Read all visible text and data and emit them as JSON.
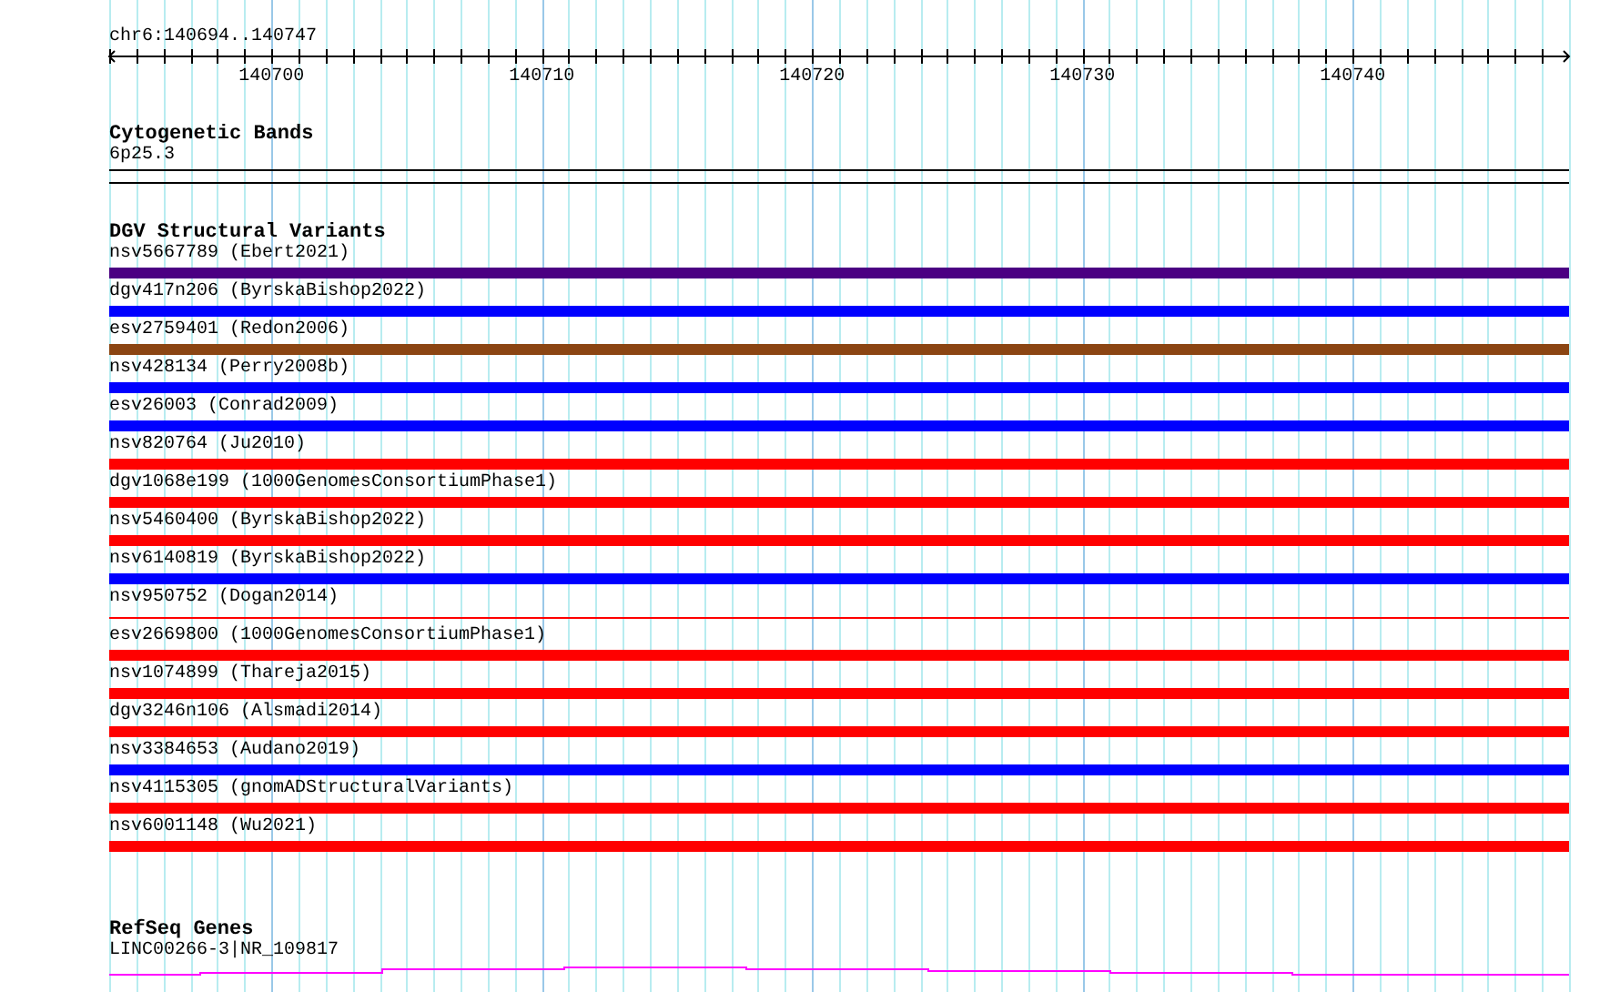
{
  "ruler": {
    "location": "chr6:140694..140747",
    "labels": [
      "140700",
      "140710",
      "140720",
      "140730",
      "140740"
    ]
  },
  "tracks": [
    {
      "kind": "bands",
      "title": "Cytogenetic Bands",
      "features": [
        {
          "label": "6p25.3"
        }
      ]
    },
    {
      "kind": "variants",
      "title": "DGV Structural Variants",
      "features": [
        {
          "label": "nsv5667789 (Ebert2021)",
          "kind": "bar",
          "color": "#4b0082"
        },
        {
          "label": "dgv417n206 (ByrskaBishop2022)",
          "kind": "bar",
          "color": "#0000ff"
        },
        {
          "label": "esv2759401 (Redon2006)",
          "kind": "bar",
          "color": "#8b4513"
        },
        {
          "label": "nsv428134 (Perry2008b)",
          "kind": "bar",
          "color": "#0000ff"
        },
        {
          "label": "esv26003 (Conrad2009)",
          "kind": "bar",
          "color": "#0000ff"
        },
        {
          "label": "nsv820764 (Ju2010)",
          "kind": "bar",
          "color": "#ff0000"
        },
        {
          "label": "dgv1068e199 (1000GenomesConsortiumPhase1)",
          "kind": "bar",
          "color": "#ff0000"
        },
        {
          "label": "nsv5460400 (ByrskaBishop2022)",
          "kind": "bar",
          "color": "#ff0000"
        },
        {
          "label": "nsv6140819 (ByrskaBishop2022)",
          "kind": "bar",
          "color": "#0000ff"
        },
        {
          "label": "nsv950752 (Dogan2014)",
          "kind": "line",
          "color": "#ff0000"
        },
        {
          "label": "esv2669800 (1000GenomesConsortiumPhase1)",
          "kind": "bar",
          "color": "#ff0000"
        },
        {
          "label": "nsv1074899 (Thareja2015)",
          "kind": "bar",
          "color": "#ff0000"
        },
        {
          "label": "dgv3246n106 (Alsmadi2014)",
          "kind": "bar",
          "color": "#ff0000"
        },
        {
          "label": "nsv3384653 (Audano2019)",
          "kind": "bar",
          "color": "#0000ff"
        },
        {
          "label": "nsv4115305 (gnomADStructuralVariants)",
          "kind": "bar",
          "color": "#ff0000"
        },
        {
          "label": "nsv6001148 (Wu2021)",
          "kind": "bar",
          "color": "#ff0000"
        }
      ]
    },
    {
      "kind": "genes",
      "title": "RefSeq Genes",
      "features": [
        {
          "label": "LINC00266-3|NR_109817"
        }
      ]
    }
  ]
}
